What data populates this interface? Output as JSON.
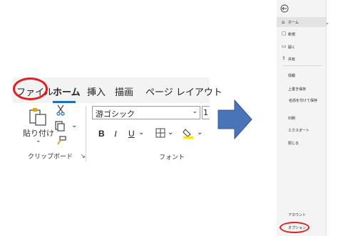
{
  "ribbon": {
    "tabs": [
      "ファイル",
      "ホーム",
      "挿入",
      "描画",
      "ページ レイアウト"
    ],
    "paste_label": "貼り付け",
    "clipboard_label": "クリップボード",
    "font_label": "フォント",
    "font_name": "游ゴシック",
    "font_size": "1",
    "bold": "B",
    "italic": "I",
    "underline": "U"
  },
  "backstage": {
    "home": "ホーム",
    "new": "新規",
    "open": "開く",
    "share": "共有",
    "info": "情報",
    "save": "上書き保存",
    "save_as": "名前を付けて保存",
    "print": "印刷",
    "export": "エクスポート",
    "close": "閉じる",
    "account": "アカウント",
    "options": "オプション"
  },
  "colors": {
    "accent": "#1a6fbf",
    "highlight": "#e02020",
    "arrow": "#4a74b8"
  }
}
